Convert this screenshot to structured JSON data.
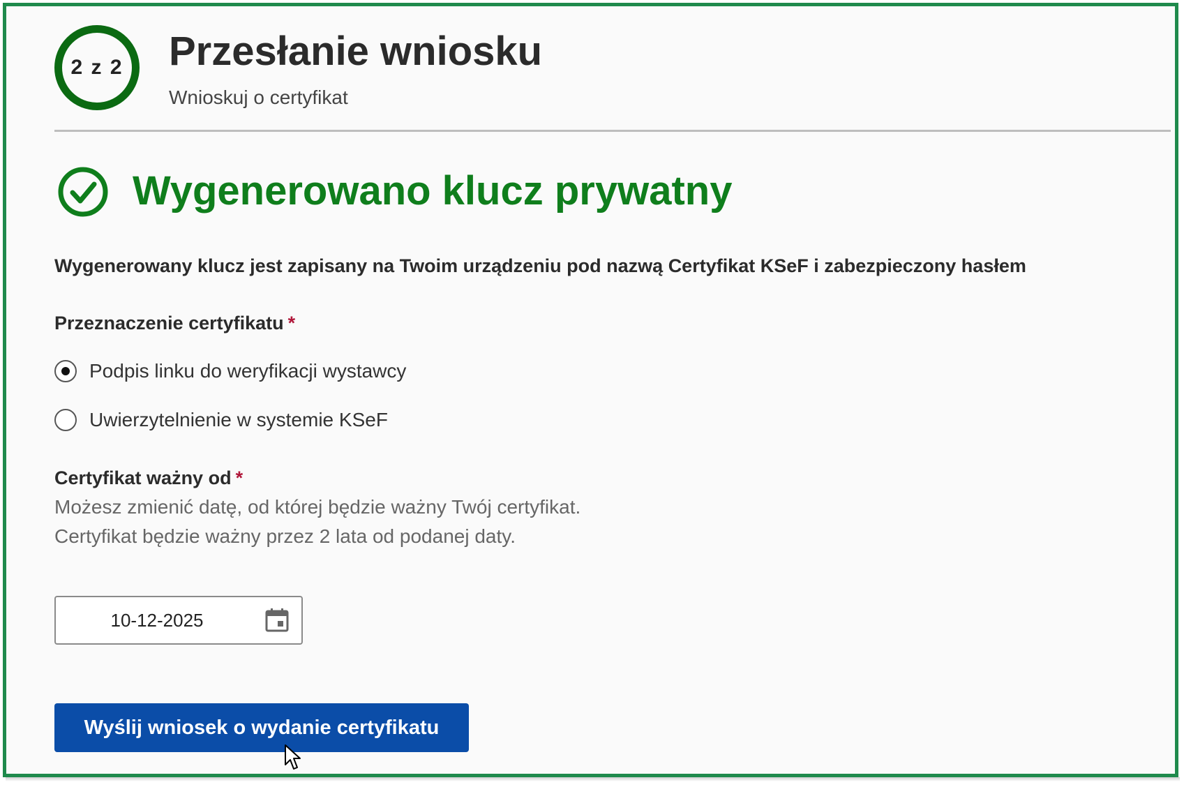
{
  "header": {
    "step_indicator": "2 z 2",
    "title": "Przesłanie wniosku",
    "subtitle": "Wnioskuj o certyfikat"
  },
  "status": {
    "icon": "check-circle-icon",
    "title": "Wygenerowano klucz prywatny",
    "color": "#0f7e1c"
  },
  "info_text": "Wygenerowany klucz jest zapisany na Twoim urządzeniu pod nazwą Certyfikat KSeF i zabezpieczony hasłem",
  "purpose": {
    "label": "Przeznaczenie certyfikatu",
    "required_mark": "*",
    "options": [
      {
        "label": "Podpis linku do weryfikacji wystawcy",
        "selected": true
      },
      {
        "label": "Uwierzytelnienie w systemie KSeF",
        "selected": false
      }
    ]
  },
  "valid_from": {
    "label": "Certyfikat ważny od",
    "required_mark": "*",
    "hint": "Możesz zmienić datę, od której będzie ważny Twój certyfikat. Certyfikat będzie ważny przez 2 lata od podanej daty.",
    "value": "10-12-2025",
    "icon": "calendar-icon"
  },
  "submit": {
    "label": "Wyślij wniosek o wydanie certyfikatu",
    "color": "#0b4da8"
  },
  "colors": {
    "frame": "#1f8a4c",
    "step_ring": "#0b6a12",
    "required": "#b0173a"
  }
}
